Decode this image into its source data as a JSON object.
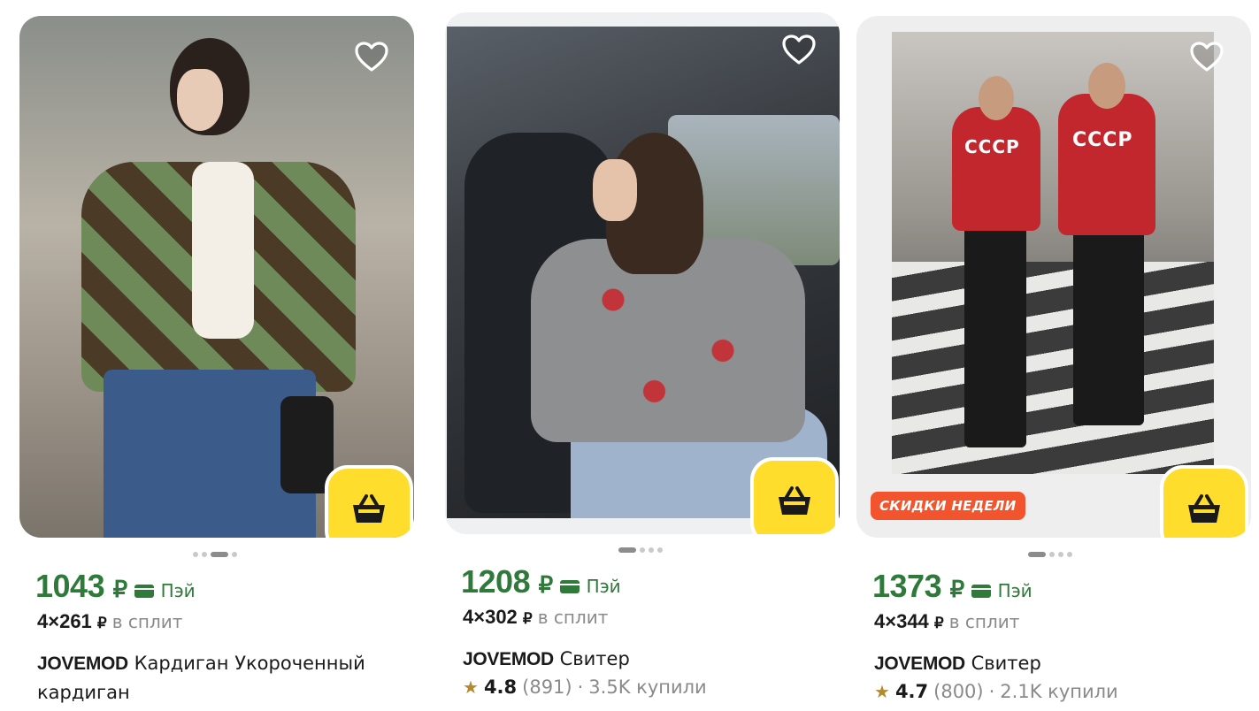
{
  "products": [
    {
      "price": "1043",
      "currency": "₽",
      "pay_label": "Пэй",
      "split_amount": "4×261",
      "split_currency": "₽",
      "split_label": "в сплит",
      "brand": "JOVEMOD",
      "name": "Кардиган Укороченный кардиган",
      "dots_active_index": 2,
      "icons": {
        "favorite": "heart-outline-icon",
        "cart": "basket-icon"
      }
    },
    {
      "price": "1208",
      "currency": "₽",
      "pay_label": "Пэй",
      "split_amount": "4×302",
      "split_currency": "₽",
      "split_label": "в сплит",
      "brand": "JOVEMOD",
      "name": "Свитер",
      "rating": "4.8",
      "reviews": "(891)",
      "separator": "·",
      "bought": "3.5K купили",
      "dots_active_index": 0,
      "icons": {
        "favorite": "heart-outline-icon",
        "cart": "basket-icon",
        "rating": "star-icon"
      }
    },
    {
      "price": "1373",
      "currency": "₽",
      "pay_label": "Пэй",
      "split_amount": "4×344",
      "split_currency": "₽",
      "split_label": "в сплит",
      "brand": "JOVEMOD",
      "name": "Свитер",
      "rating": "4.7",
      "reviews": "(800)",
      "separator": "·",
      "bought": "2.1K купили",
      "badge": "СКИДКИ НЕДЕЛИ",
      "image_text": "СССР",
      "dots_active_index": 0,
      "icons": {
        "favorite": "heart-outline-icon",
        "cart": "basket-icon",
        "rating": "star-icon"
      }
    }
  ],
  "colors": {
    "price_green": "#2f7a3a",
    "cart_yellow": "#ffdd2d",
    "badge_orange": "#f2552e",
    "muted_text": "#8a8a8a",
    "star": "#b38b2e"
  }
}
